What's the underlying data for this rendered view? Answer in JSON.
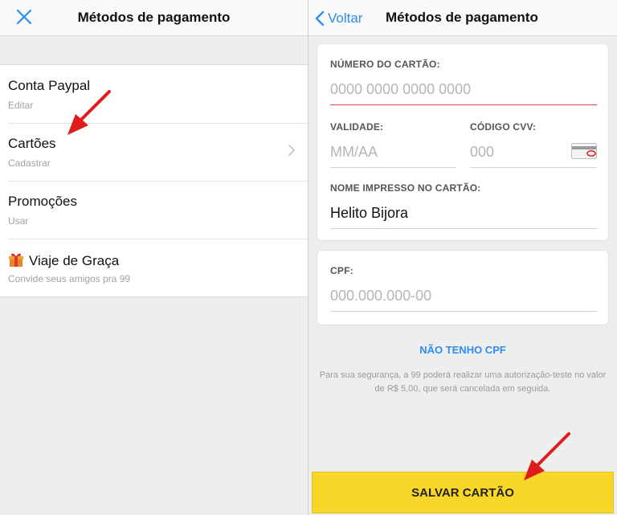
{
  "left": {
    "title": "Métodos de pagamento",
    "items": [
      {
        "title": "Conta Paypal",
        "subtitle": "Editar"
      },
      {
        "title": "Cartões",
        "subtitle": "Cadastrar"
      },
      {
        "title": "Promoções",
        "subtitle": "Usar"
      },
      {
        "title": "Viaje de Graça",
        "subtitle": "Convide seus amigos pra 99"
      }
    ]
  },
  "right": {
    "back_label": "Voltar",
    "title": "Métodos de pagamento",
    "card_number": {
      "label": "NÚMERO DO CARTÃO:",
      "placeholder": "0000 0000 0000 0000"
    },
    "expiry": {
      "label": "VALIDADE:",
      "placeholder": "MM/AA"
    },
    "cvv": {
      "label": "CÓDIGO CVV:",
      "placeholder": "000"
    },
    "name": {
      "label": "NOME IMPRESSO NO CARTÃO:",
      "value": "Helito Bijora"
    },
    "cpf": {
      "label": "CPF:",
      "placeholder": "000.000.000-00"
    },
    "no_cpf_link": "NÃO TENHO CPF",
    "notice": "Para sua segurança, a 99 poderá realizar uma autorização-teste no valor de R$ 5,00, que será cancelada em seguida.",
    "save_button": "SALVAR CARTÃO"
  },
  "colors": {
    "accent_blue": "#2d8ef0",
    "save_yellow": "#f8d729",
    "active_underline": "#e8484e",
    "annotation_arrow": "#e01b1b"
  },
  "icons": [
    "close-icon",
    "chevron-right-icon",
    "gift-icon",
    "chevron-left-icon",
    "card-back-icon",
    "red-arrow-annotation"
  ]
}
